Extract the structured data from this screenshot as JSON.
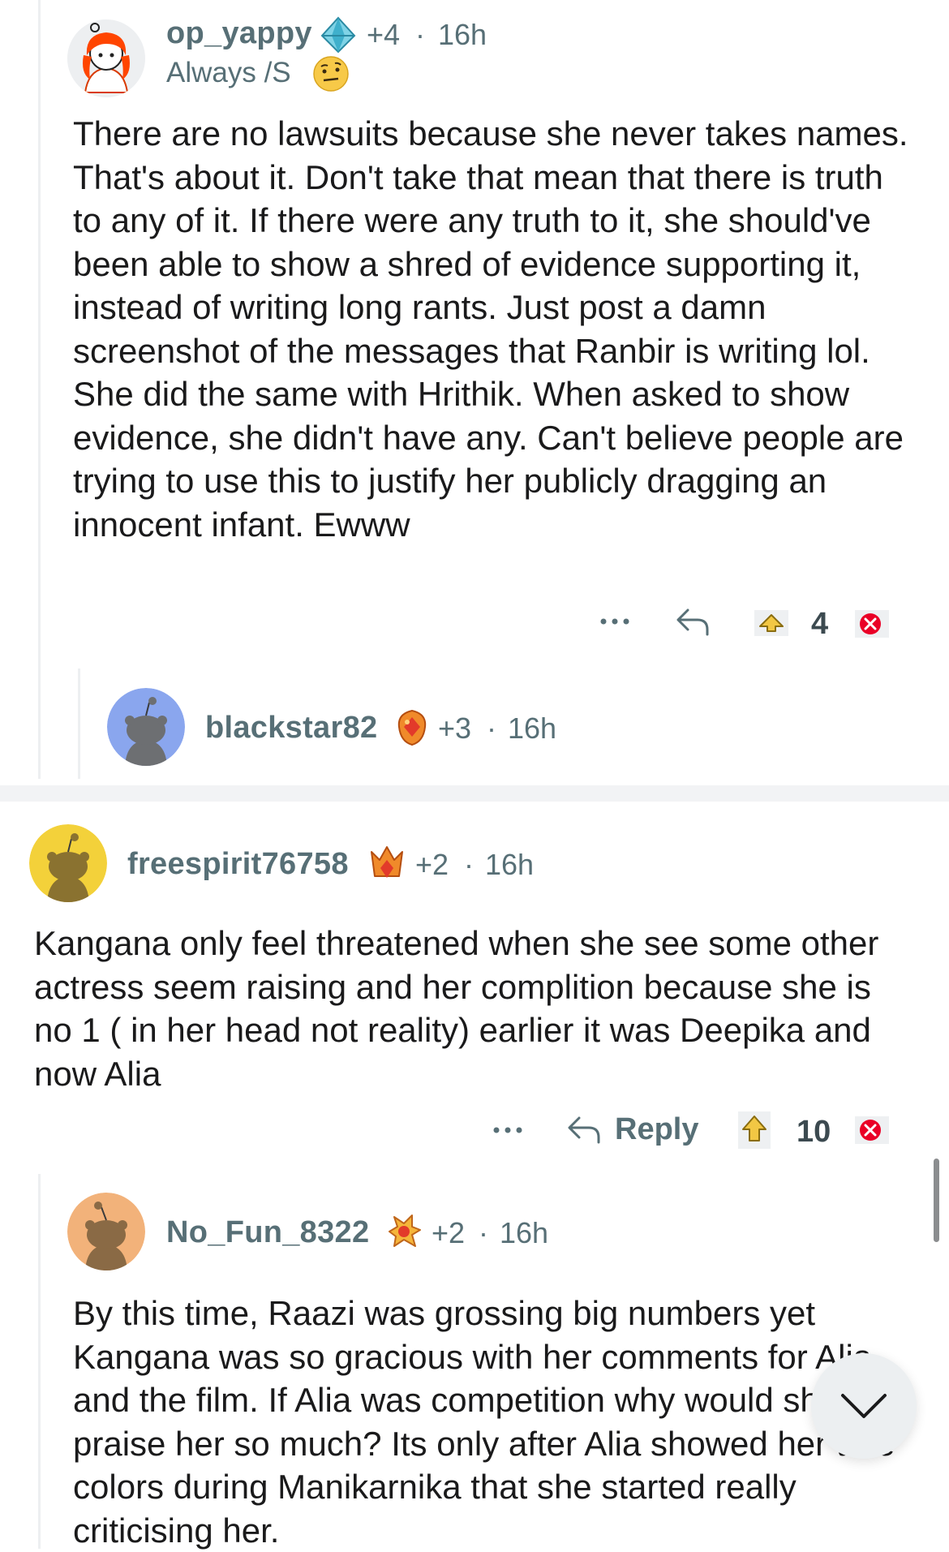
{
  "comments": [
    {
      "username": "op_yappy",
      "award_count": "+4",
      "separator": "·",
      "time": "16h",
      "flair_text": "Always /S",
      "body": "There are no lawsuits because she never takes names. That's about it. Don't take that mean that there is truth to any of it. If there were any truth to it, she should've been able to show a shred of evidence supporting it, instead of writing long rants. Just post a damn screenshot of the messages that Ranbir is writing lol. She did the same with Hrithik. When asked to show evidence, she didn't have any. Can't believe people are trying to use this to justify her publicly dragging an innocent infant. Ewww",
      "score": "4"
    },
    {
      "username": "blackstar82",
      "award_count": "+3",
      "separator": "·",
      "time": "16h"
    },
    {
      "username": "freespirit76758",
      "award_count": "+2",
      "separator": "·",
      "time": "16h",
      "body": "Kangana only feel threatened when she see some other actress seem raising and her complition because she is no 1 ( in her head not reality) earlier it was Deepika and now Alia",
      "reply_label": "Reply",
      "score": "10"
    },
    {
      "username": "No_Fun_8322",
      "award_count": "+2",
      "separator": "·",
      "time": "16h",
      "body": "By this time, Raazi was grossing big numbers yet Kangana was so gracious with her comments for Alia and the film. If Alia was competition why would she praise her so much? Its only after Alia showed her true colors during Manikarnika that she started really criticising her."
    }
  ],
  "icons": {
    "more": "more-dots-icon",
    "reply": "reply-arrow-icon",
    "upvote": "upvote-icon",
    "downvote": "downvote-icon",
    "scroll_down": "chevron-down-icon"
  },
  "colors": {
    "meta_gray": "#576f76",
    "text": "#1a1a1b",
    "downvote_red": "#ea0027",
    "upvote_yellow": "#f2c744"
  }
}
